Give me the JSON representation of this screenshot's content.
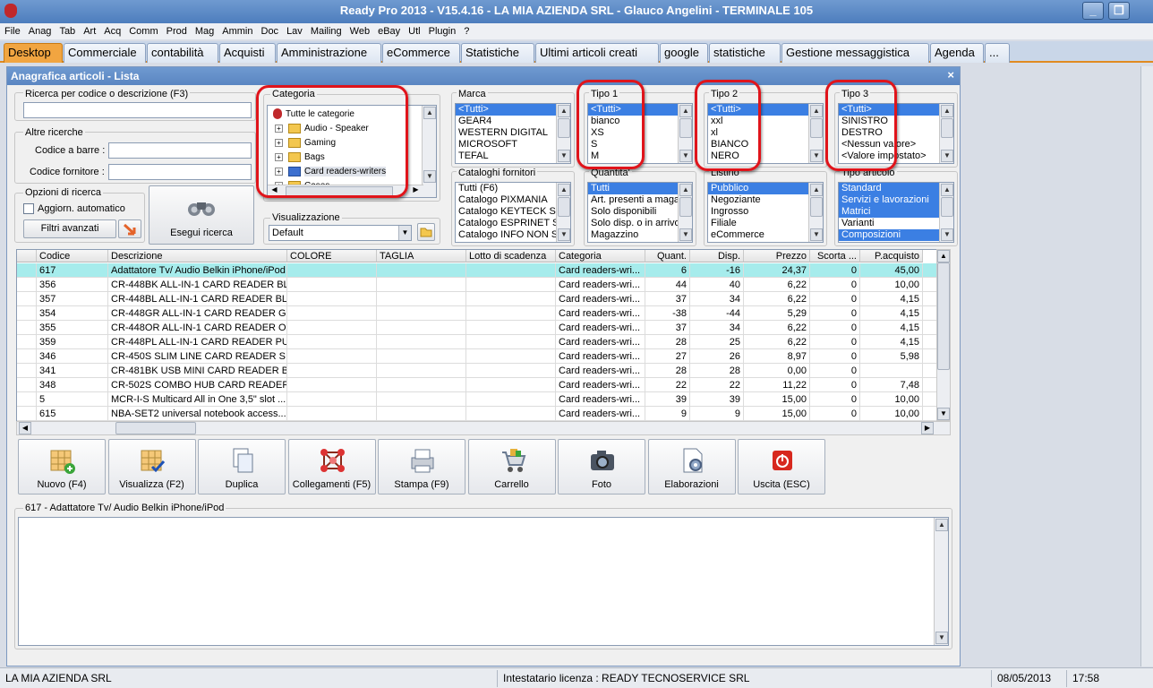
{
  "window": {
    "title": "Ready Pro 2013 - V15.4.16 - LA MIA AZIENDA SRL - Glauco Angelini - TERMINALE 105"
  },
  "menu": [
    "File",
    "Anag",
    "Tab",
    "Art",
    "Acq",
    "Comm",
    "Prod",
    "Mag",
    "Ammin",
    "Doc",
    "Lav",
    "Mailing",
    "Web",
    "eBay",
    "Utl",
    "Plugin",
    "?"
  ],
  "tabs": [
    "Desktop",
    "Commerciale",
    "contabilità",
    "Acquisti",
    "Amministrazione",
    "eCommerce",
    "Statistiche",
    "Ultimi articoli creati",
    "google",
    "statistiche",
    "Gestione messaggistica",
    "Agenda",
    "..."
  ],
  "inner": {
    "title": "Anagrafica articoli  - Lista",
    "close": "×"
  },
  "search": {
    "label": "Ricerca per codice o descrizione (F3)",
    "value": ""
  },
  "other": {
    "label": "Altre ricerche",
    "barcode_label": "Codice a barre :",
    "supplier_label": "Codice fornitore :"
  },
  "options": {
    "label": "Opzioni di ricerca",
    "auto_update": "Aggiorn. automatico",
    "filters": "Filtri avanzati"
  },
  "execute": {
    "label": "Esegui ricerca"
  },
  "categoria": {
    "label": "Categoria",
    "items": [
      "Tutte le categorie",
      "Audio - Speaker",
      "Gaming",
      "Bags",
      "Card readers-writers",
      "Cases"
    ]
  },
  "visualizzazione": {
    "label": "Visualizzazione",
    "value": "Default"
  },
  "marca": {
    "label": "Marca",
    "items": [
      "<Tutti>",
      "GEAR4",
      "WESTERN DIGITAL",
      "MICROSOFT",
      "TEFAL"
    ]
  },
  "tipo1": {
    "label": "Tipo 1",
    "items": [
      "<Tutti>",
      "bianco",
      "XS",
      "S",
      "M"
    ]
  },
  "tipo2": {
    "label": "Tipo 2",
    "items": [
      "<Tutti>",
      "xxl",
      "xl",
      "BIANCO",
      "NERO"
    ]
  },
  "tipo3": {
    "label": "Tipo 3",
    "items": [
      "<Tutti>",
      "SINISTRO",
      "DESTRO",
      "<Nessun valore>",
      "<Valore impostato>"
    ]
  },
  "cataloghi": {
    "label": "Cataloghi fornitori",
    "items": [
      "Tutti (F6)",
      "Catalogo PIXMANIA",
      "Catalogo KEYTECK SRL",
      "Catalogo ESPRINET SP",
      "Catalogo INFO NON SC"
    ]
  },
  "quantita": {
    "label": "Quantita'",
    "items": [
      "Tutti",
      "Art. presenti a maga",
      "Solo disponibili",
      "Solo disp. o in arrivo",
      "Magazzino"
    ]
  },
  "listino": {
    "label": "Listino",
    "items": [
      "Pubblico",
      "Negoziante",
      "Ingrosso",
      "Filiale",
      "eCommerce"
    ]
  },
  "tipo_articolo": {
    "label": "Tipo articolo",
    "items": [
      "Standard",
      "Servizi e lavorazioni",
      "Matrici",
      "Varianti",
      "Composizioni"
    ]
  },
  "grid": {
    "columns": [
      "Codice",
      "Descrizione",
      "COLORE",
      "TAGLIA",
      "Lotto di scadenza",
      "Categoria",
      "Quant.",
      "Disp.",
      "Prezzo",
      "Scorta ...",
      "P.acquisto"
    ],
    "rows": [
      [
        "617",
        "Adattatore Tv/ Audio Belkin iPhone/iPod",
        "",
        "",
        "",
        "Card readers-wri...",
        "6",
        "-16",
        "24,37",
        "0",
        "45,00"
      ],
      [
        "356",
        "CR-448BK ALL-IN-1 CARD READER BL...",
        "",
        "",
        "",
        "Card readers-wri...",
        "44",
        "40",
        "6,22",
        "0",
        "10,00"
      ],
      [
        "357",
        "CR-448BL ALL-IN-1 CARD READER BLUE",
        "",
        "",
        "",
        "Card readers-wri...",
        "37",
        "34",
        "6,22",
        "0",
        "4,15"
      ],
      [
        "354",
        "CR-448GR ALL-IN-1 CARD READER G...",
        "",
        "",
        "",
        "Card readers-wri...",
        "-38",
        "-44",
        "5,29",
        "0",
        "4,15"
      ],
      [
        "355",
        "CR-448OR ALL-IN-1 CARD READER O...",
        "",
        "",
        "",
        "Card readers-wri...",
        "37",
        "34",
        "6,22",
        "0",
        "4,15"
      ],
      [
        "359",
        "CR-448PL ALL-IN-1 CARD READER PU...",
        "",
        "",
        "",
        "Card readers-wri...",
        "28",
        "25",
        "6,22",
        "0",
        "4,15"
      ],
      [
        "346",
        "CR-450S SLIM LINE CARD READER SI...",
        "",
        "",
        "",
        "Card readers-wri...",
        "27",
        "26",
        "8,97",
        "0",
        "5,98"
      ],
      [
        "341",
        "CR-481BK USB MINI CARD READER B...",
        "",
        "",
        "",
        "Card readers-wri...",
        "28",
        "28",
        "0,00",
        "0",
        ""
      ],
      [
        "348",
        "CR-502S COMBO HUB CARD READER ...",
        "",
        "",
        "",
        "Card readers-wri...",
        "22",
        "22",
        "11,22",
        "0",
        "7,48"
      ],
      [
        "5",
        "MCR-I-S Multicard All in One 3,5\" slot ...",
        "",
        "",
        "",
        "Card readers-wri...",
        "39",
        "39",
        "15,00",
        "0",
        "10,00"
      ],
      [
        "615",
        "NBA-SET2 universal notebook access...",
        "",
        "",
        "",
        "Card readers-wri...",
        "9",
        "9",
        "15,00",
        "0",
        "10,00"
      ]
    ]
  },
  "toolbar": [
    "Nuovo (F4)",
    "Visualizza (F2)",
    "Duplica",
    "Collegamenti (F5)",
    "Stampa (F9)",
    "Carrello",
    "Foto",
    "Elaborazioni",
    "Uscita (ESC)"
  ],
  "detail": {
    "label": "617 - Adattatore Tv/ Audio Belkin iPhone/iPod"
  },
  "status": {
    "company": "LA MIA AZIENDA SRL",
    "license": "Intestatario licenza : READY TECNOSERVICE SRL",
    "date": "08/05/2013",
    "time": "17:58"
  }
}
